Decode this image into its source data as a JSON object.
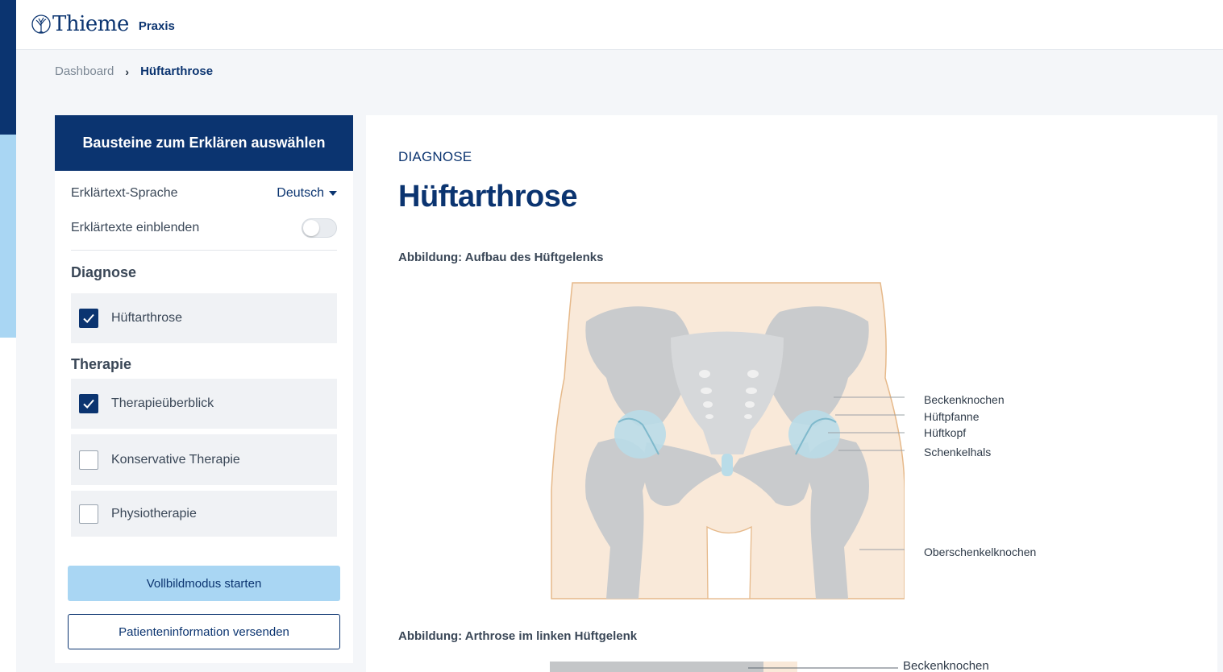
{
  "header": {
    "brand": "Thieme",
    "product": "Praxis"
  },
  "breadcrumb": {
    "items": [
      "Dashboard",
      "Hüftarthrose"
    ],
    "separator": "›"
  },
  "panel": {
    "title": "Bausteine zum Erklären auswählen",
    "language_label": "Erklärtext-Sprache",
    "language_value": "Deutsch",
    "show_texts_label": "Erklärtexte einblenden",
    "show_texts_enabled": false,
    "sections": [
      {
        "title": "Diagnose",
        "options": [
          {
            "label": "Hüftarthrose",
            "checked": true
          }
        ]
      },
      {
        "title": "Therapie",
        "options": [
          {
            "label": "Therapieüberblick",
            "checked": true
          },
          {
            "label": "Konservative Therapie",
            "checked": false
          },
          {
            "label": "Physiotherapie",
            "checked": false
          }
        ]
      }
    ],
    "fullscreen_button": "Vollbildmodus starten",
    "send_button": "Patienteninformation versenden"
  },
  "content": {
    "kicker": "DIAGNOSE",
    "title": "Hüftarthrose",
    "figures": [
      {
        "caption": "Abbildung: Aufbau des Hüftgelenks",
        "labels": [
          "Beckenknochen",
          "Hüftpfanne",
          "Hüftkopf",
          "Schenkelhals",
          "Oberschenkelknochen"
        ]
      },
      {
        "caption": "Abbildung: Arthrose im linken Hüftgelenk",
        "labels": [
          "Beckenknochen"
        ]
      }
    ]
  },
  "colors": {
    "brand_navy": "#0b3470",
    "accent_light_blue": "#a9d6f3",
    "skin": "#f9e9d9",
    "bone": "#c9cbcd",
    "cartilage": "#b9dce8"
  }
}
